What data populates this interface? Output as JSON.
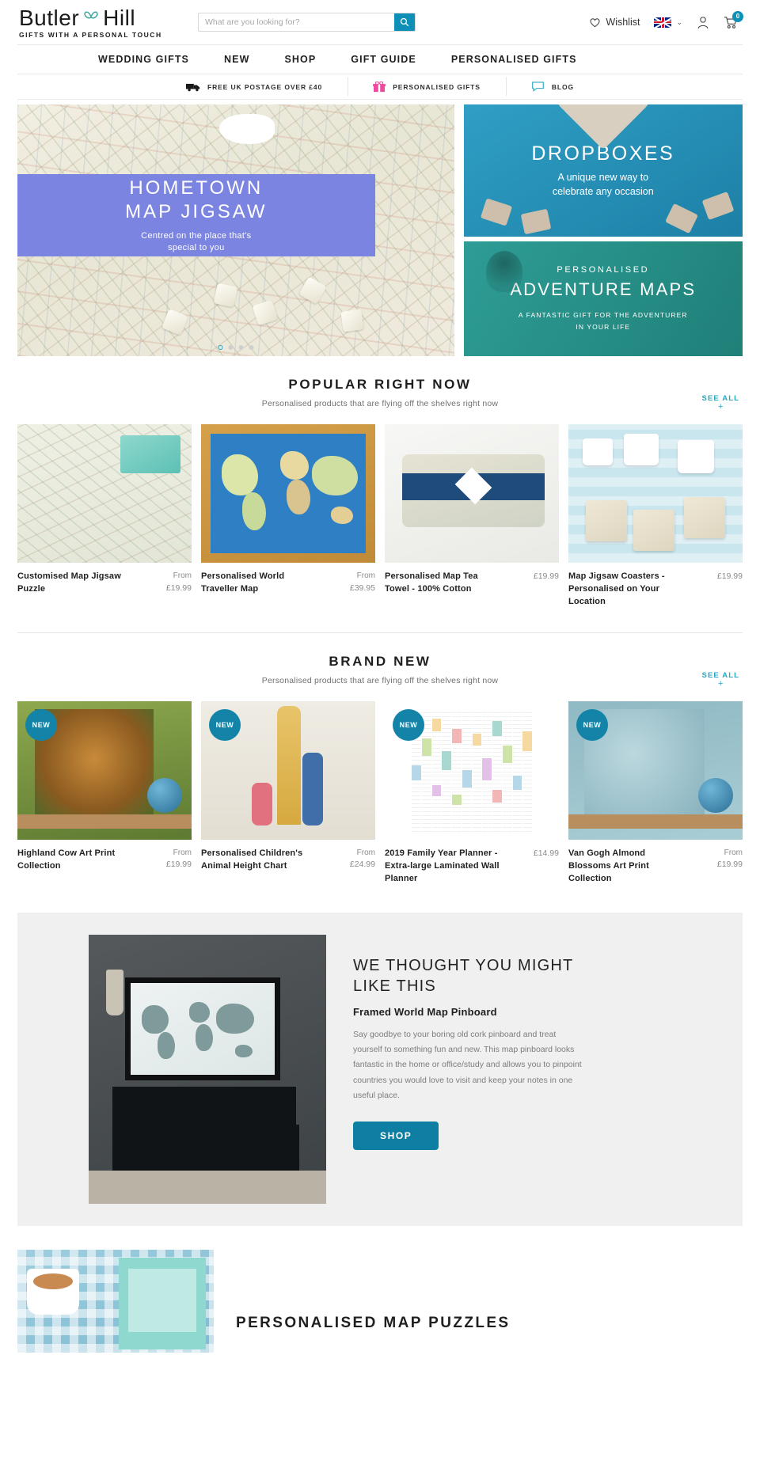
{
  "header": {
    "logo_main": "Butler",
    "logo_main2": "Hill",
    "logo_heart": "heart-icon",
    "logo_tagline": "GIFTS WITH A PERSONAL TOUCH",
    "search_placeholder": "What are you looking for?",
    "search_value": "",
    "search_icon": "search-icon",
    "wishlist_label": "Wishlist",
    "wishlist_icon": "heart-outline-icon",
    "flag_label": "UK",
    "chevron": "⌄",
    "account_icon": "user-icon",
    "cart_icon": "cart-icon",
    "cart_count": "0"
  },
  "nav": {
    "items": [
      {
        "label": "WEDDING GIFTS"
      },
      {
        "label": "NEW"
      },
      {
        "label": "SHOP"
      },
      {
        "label": "GIFT GUIDE"
      },
      {
        "label": "PERSONALISED GIFTS"
      }
    ]
  },
  "promo": {
    "items": [
      {
        "label": "FREE UK POSTAGE OVER £40",
        "icon": "truck-icon"
      },
      {
        "label": "PERSONALISED GIFTS",
        "icon": "gift-icon"
      },
      {
        "label": "BLOG",
        "icon": "chat-icon"
      }
    ]
  },
  "hero": {
    "left": {
      "title_line1": "HOMETOWN",
      "title_line2": "MAP JIGSAW",
      "subtitle_line1": "Centred on the place that's",
      "subtitle_line2": "special to you",
      "dots": 4,
      "active_dot": 0
    },
    "top_right": {
      "title": "DROPBOXES",
      "line1": "A unique new way to",
      "line2": "celebrate any occasion"
    },
    "bottom_right": {
      "small": "PERSONALISED",
      "large": "ADVENTURE MAPS",
      "tiny_line1": "A FANTASTIC GIFT FOR THE ADVENTURER",
      "tiny_line2": "IN YOUR LIFE"
    }
  },
  "popular": {
    "title": "POPULAR RIGHT NOW",
    "subtitle": "Personalised products that are flying off the shelves right now",
    "see_all": "SEE ALL",
    "see_all_plus": "+",
    "products": [
      {
        "name": "Customised Map Jigsaw Puzzle",
        "from": "From",
        "price": "£19.99",
        "art": "map1"
      },
      {
        "name": "Personalised World Traveller Map",
        "from": "From",
        "price": "£39.95",
        "art": "world"
      },
      {
        "name": "Personalised Map Tea Towel - 100% Cotton",
        "from": "",
        "price": "£19.99",
        "art": "towel"
      },
      {
        "name": "Map Jigsaw Coasters - Personalised on Your Location",
        "from": "",
        "price": "£19.99",
        "art": "coast"
      }
    ]
  },
  "brandnew": {
    "title": "BRAND NEW",
    "subtitle": "Personalised products that are flying off the shelves right now",
    "see_all": "SEE ALL",
    "see_all_plus": "+",
    "badge": "NEW",
    "products": [
      {
        "name": "Highland Cow Art Print Collection",
        "from": "From",
        "price": "£19.99",
        "art": "cow"
      },
      {
        "name": "Personalised Children's Animal Height Chart",
        "from": "From",
        "price": "£24.99",
        "art": "height"
      },
      {
        "name": "2019 Family Year Planner - Extra-large Laminated Wall Planner",
        "from": "",
        "price": "£14.99",
        "art": "planner"
      },
      {
        "name": "Van Gogh Almond Blossoms Art Print Collection",
        "from": "From",
        "price": "£19.99",
        "art": "vangogh"
      }
    ]
  },
  "feature": {
    "title": "WE THOUGHT YOU MIGHT LIKE THIS",
    "product": "Framed World Map Pinboard",
    "description": "Say goodbye to your boring old cork pinboard and treat yourself to something fun and new. This map pinboard looks fantastic in the home or office/study and allows you to pinpoint countries you would love to visit and keep your notes in one useful place.",
    "button": "SHOP"
  },
  "bottom": {
    "title": "PERSONALISED MAP PUZZLES"
  },
  "colors": {
    "accent": "#0e8fb5",
    "teal": "#2aa6bf",
    "periwinkle": "#7b84e0",
    "badge": "#1383a8"
  }
}
